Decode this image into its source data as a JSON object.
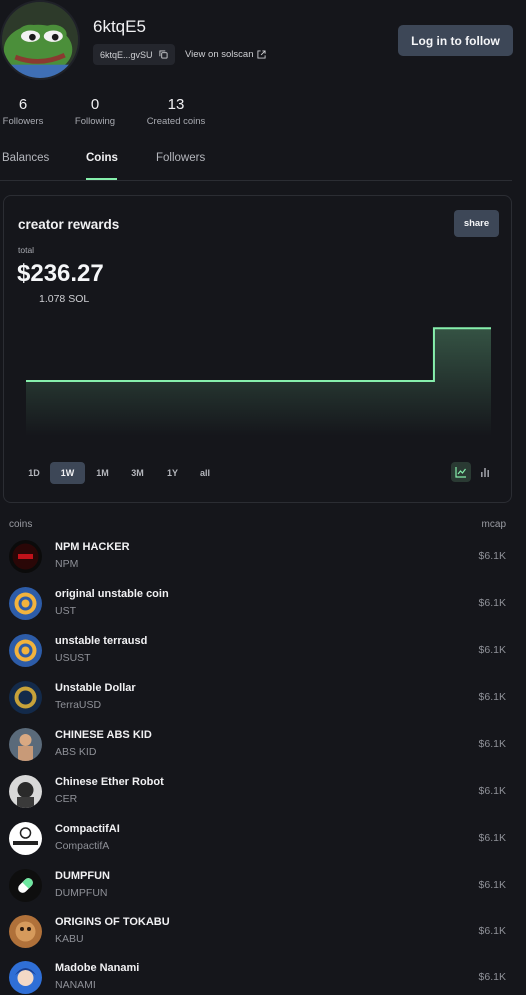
{
  "profile": {
    "username": "6ktqE5",
    "address_short": "6ktqE...gvSU",
    "solscan_label": "View on solscan",
    "follow_button": "Log in to follow"
  },
  "stats": [
    {
      "value": "6",
      "label": "Followers"
    },
    {
      "value": "0",
      "label": "Following"
    },
    {
      "value": "13",
      "label": "Created coins"
    }
  ],
  "tabs": [
    {
      "label": "Balances",
      "active": false
    },
    {
      "label": "Coins",
      "active": true
    },
    {
      "label": "Followers",
      "active": false
    }
  ],
  "rewards": {
    "title": "creator rewards",
    "share_label": "share",
    "total_label": "total",
    "total_usd": "$236.27",
    "total_sol": "1.078 SOL",
    "ranges": [
      "1D",
      "1W",
      "1M",
      "3M",
      "1Y",
      "all"
    ],
    "active_range": "1W",
    "line_color": "#86efac"
  },
  "chart_data": {
    "type": "area",
    "series": [
      {
        "values": [
          0.55,
          0.55,
          0.55,
          0.55,
          0.55,
          0.55,
          0.55,
          0.55,
          0.55,
          0.55,
          1.078,
          1.078
        ]
      }
    ],
    "y_range": [
      0,
      1.15
    ],
    "grid": false
  },
  "coins_header": {
    "left": "coins",
    "right": "mcap"
  },
  "coins": [
    {
      "name": "NPM HACKER",
      "symbol": "NPM",
      "mcap": "$6.1K",
      "icon": "npm-hacker-icon"
    },
    {
      "name": "original unstable coin",
      "symbol": "UST",
      "mcap": "$6.1K",
      "icon": "ust-coin-icon"
    },
    {
      "name": "unstable terrausd",
      "symbol": "USUST",
      "mcap": "$6.1K",
      "icon": "usust-coin-icon"
    },
    {
      "name": "Unstable Dollar",
      "symbol": "TerraUSD",
      "mcap": "$6.1K",
      "icon": "terrausd-coin-icon"
    },
    {
      "name": "CHINESE ABS KID",
      "symbol": "ABS KID",
      "mcap": "$6.1K",
      "icon": "abs-kid-icon"
    },
    {
      "name": "Chinese Ether Robot",
      "symbol": "CER",
      "mcap": "$6.1K",
      "icon": "ether-robot-icon"
    },
    {
      "name": "CompactifAI",
      "symbol": "CompactifA",
      "mcap": "$6.1K",
      "icon": "compactifai-icon"
    },
    {
      "name": "DUMPFUN",
      "symbol": "DUMPFUN",
      "mcap": "$6.1K",
      "icon": "dumpfun-pill-icon"
    },
    {
      "name": "ORIGINS OF TOKABU",
      "symbol": "KABU",
      "mcap": "$6.1K",
      "icon": "kabu-icon"
    },
    {
      "name": "Madobe Nanami",
      "symbol": "NANAMI",
      "mcap": "$6.1K",
      "icon": "nanami-icon"
    }
  ]
}
